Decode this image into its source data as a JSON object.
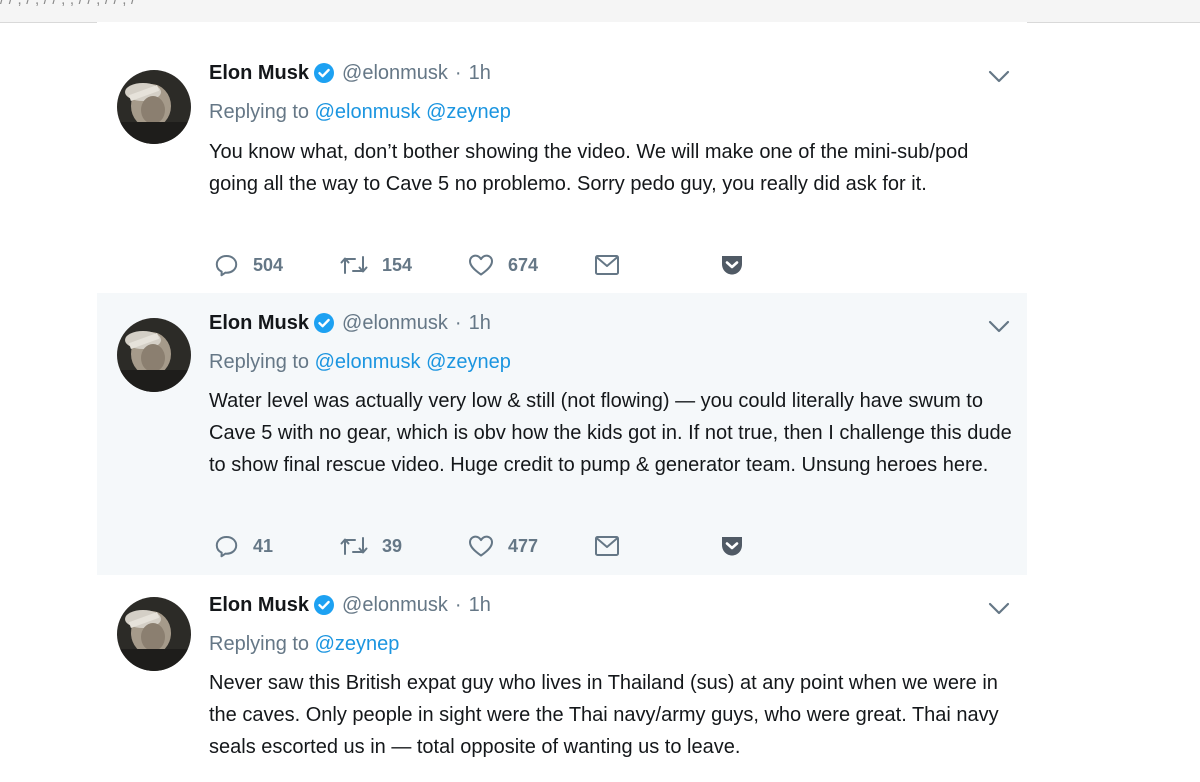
{
  "browser": {
    "address_fragment": "/ /  ,  /  ,  /  /  ,   ,  /  /   ,  /  /  ,  /"
  },
  "colors": {
    "link": "#1b95e0",
    "muted": "#657786",
    "text": "#14171a",
    "highlight_bg": "#f5f8fa",
    "pocket": "#505a65"
  },
  "tweets": [
    {
      "name": "Elon Musk",
      "handle": "@elonmusk",
      "separator": "·",
      "time": "1h",
      "replying_prefix": "Replying to",
      "replying_to": [
        "@elonmusk",
        "@zeynep"
      ],
      "text": "You know what, don’t bother showing the video. We will make one of the mini-sub/pod going all the way to Cave 5 no problemo. Sorry pedo guy, you really did ask for it.",
      "counts": {
        "replies": "504",
        "retweets": "154",
        "likes": "674"
      },
      "icons": [
        "reply-icon",
        "retweet-icon",
        "like-icon",
        "message-icon",
        "pocket-icon"
      ]
    },
    {
      "name": "Elon Musk",
      "handle": "@elonmusk",
      "separator": "·",
      "time": "1h",
      "replying_prefix": "Replying to",
      "replying_to": [
        "@elonmusk",
        "@zeynep"
      ],
      "text": "Water level was actually very low & still (not flowing) — you could literally have swum to Cave 5 with no gear, which is obv how the kids got in. If not true, then I challenge this dude to show final rescue video. Huge credit to pump & generator team. Unsung heroes here.",
      "counts": {
        "replies": "41",
        "retweets": "39",
        "likes": "477"
      },
      "icons": [
        "reply-icon",
        "retweet-icon",
        "like-icon",
        "message-icon",
        "pocket-icon"
      ]
    },
    {
      "name": "Elon Musk",
      "handle": "@elonmusk",
      "separator": "·",
      "time": "1h",
      "replying_prefix": "Replying to",
      "replying_to": [
        "@zeynep"
      ],
      "text": "Never saw this British expat guy who lives in Thailand (sus) at any point when we were in the caves. Only people in sight were the Thai navy/army guys, who were great. Thai navy seals escorted us in — total opposite of wanting us to leave."
    }
  ]
}
